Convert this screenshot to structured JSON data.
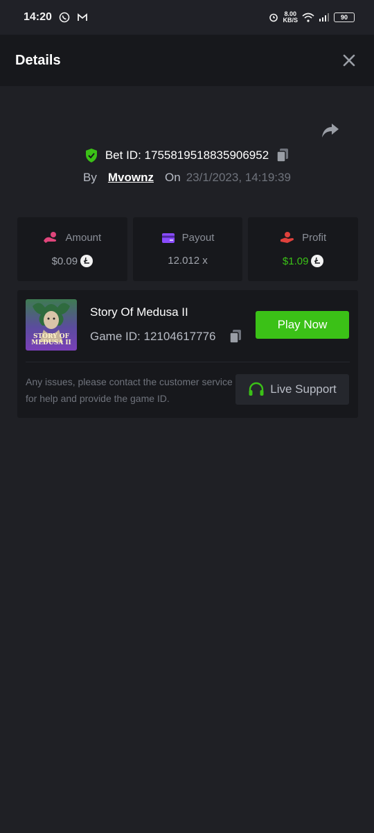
{
  "status_bar": {
    "time": "14:20",
    "speed_value": "8.00",
    "speed_unit": "KB/S",
    "battery": "90"
  },
  "header": {
    "title": "Details"
  },
  "bet": {
    "id_label": "Bet ID:",
    "id_value": "1755819518835906952",
    "by_label": "By",
    "username": "Mvownz",
    "on_label": "On",
    "date": "23/1/2023, 14:19:39"
  },
  "stats": {
    "amount": {
      "label": "Amount",
      "value": "$0.09"
    },
    "payout": {
      "label": "Payout",
      "value": "12.012 x"
    },
    "profit": {
      "label": "Profit",
      "value": "$1.09"
    }
  },
  "game": {
    "name": "Story Of Medusa II",
    "id_label": "Game ID:",
    "id_value": "12104617776",
    "thumb_line1": "STORY OF",
    "thumb_line2": "MEDUSA II",
    "play_label": "Play Now",
    "help_text": "Any issues, please contact the customer service for help and provide the game ID.",
    "support_label": "Live Support"
  },
  "colors": {
    "background": "#1f2025",
    "panel": "#17181c",
    "accent_green": "#3bc117",
    "amount_icon": "#e0457b",
    "payout_icon": "#8a4bff",
    "profit_icon": "#e0413c"
  }
}
